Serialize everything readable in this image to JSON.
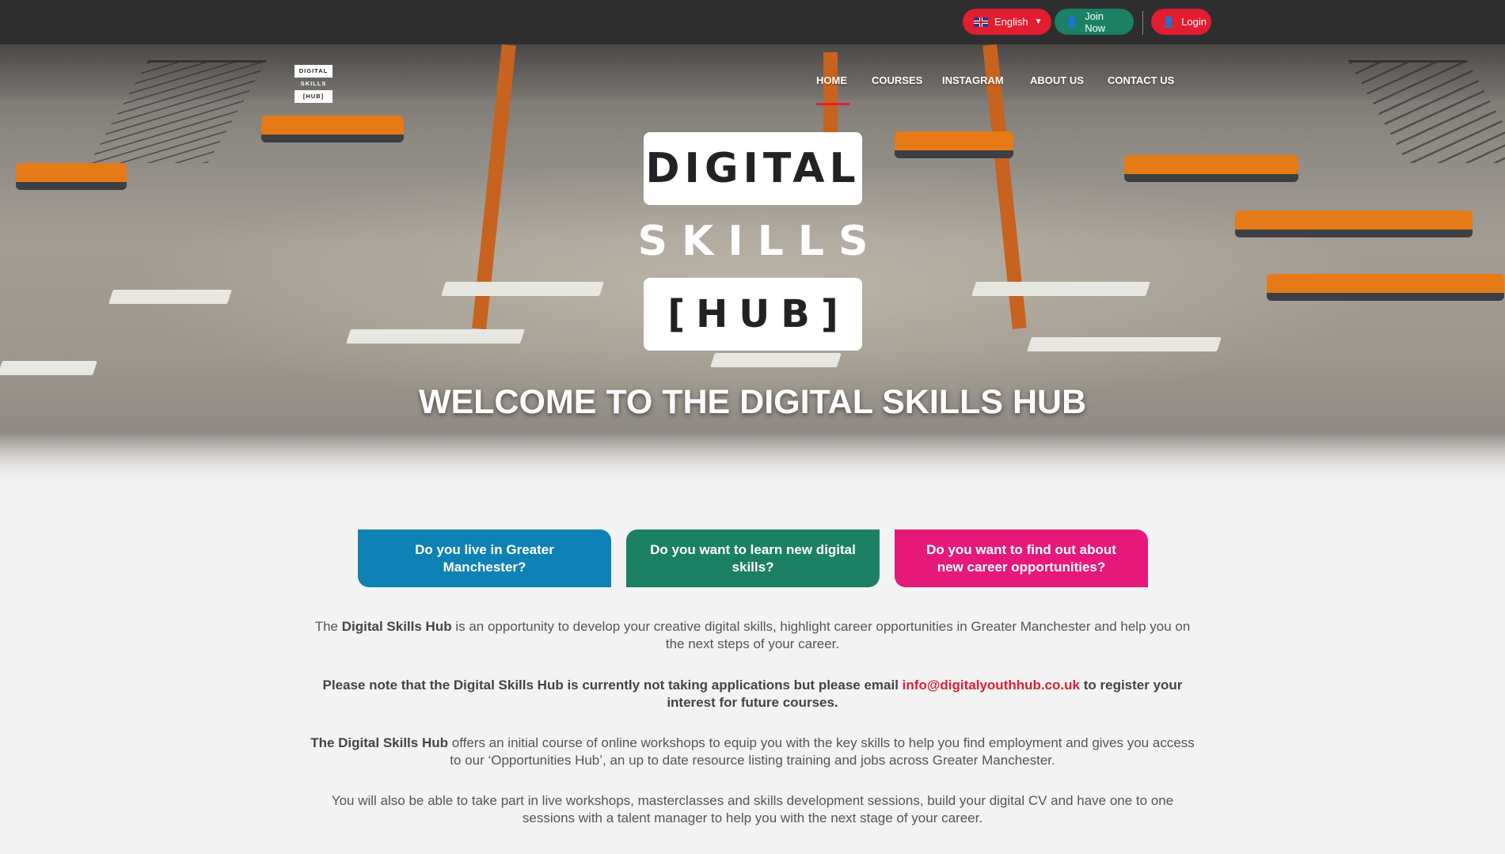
{
  "topbar": {
    "language_label": "English",
    "join_label": "Join Now",
    "login_label": "Login"
  },
  "nav": {
    "logo_lines": [
      "DIGITAL",
      "SKILLS",
      "[HUB]"
    ],
    "items": [
      {
        "label": "HOME",
        "active": true
      },
      {
        "label": "COURSES"
      },
      {
        "label": "INSTAGRAM"
      },
      {
        "label": "ABOUT US"
      },
      {
        "label": "CONTACT US"
      }
    ]
  },
  "hero": {
    "logo_line1": "DIGITAL",
    "logo_line2": "SKILLS",
    "logo_line3": "[HUB]",
    "title": "WELCOME TO THE DIGITAL SKILLS HUB"
  },
  "cta": {
    "manchester": "Do you live in Greater Manchester?",
    "learn": "Do you want to learn new digital skills?",
    "career": "Do you want to find out about new career opportunities?"
  },
  "content": {
    "p1_prefix": "The ",
    "p1_bold": "Digital Skills Hub",
    "p1_rest": " is an opportunity to develop your creative digital skills, highlight career opportunities in Greater Manchester and help you on the next steps of your career.",
    "p2_prefix": "Please note that the Digital Skills Hub is currently not taking applications but please email ",
    "p2_email": "info@digitalyouthhub.co.uk",
    "p2_suffix": " to register your interest for future courses.",
    "p3_bold": "The Digital Skills Hub",
    "p3_rest": " offers an initial course of online workshops to equip you with the key skills to help you find employment and gives you access to our ‘Opportunities Hub’, an up to date resource listing training and jobs across Greater Manchester.",
    "p4": "You will also be able to take part in live workshops, masterclasses and skills development sessions, build your digital CV and have one to one sessions with a talent manager to help you with the next stage of your career."
  },
  "colors": {
    "brand_red": "#e11d2f",
    "brand_green": "#1b8064",
    "brand_blue": "#0f82b5",
    "brand_pink": "#e6197a"
  }
}
